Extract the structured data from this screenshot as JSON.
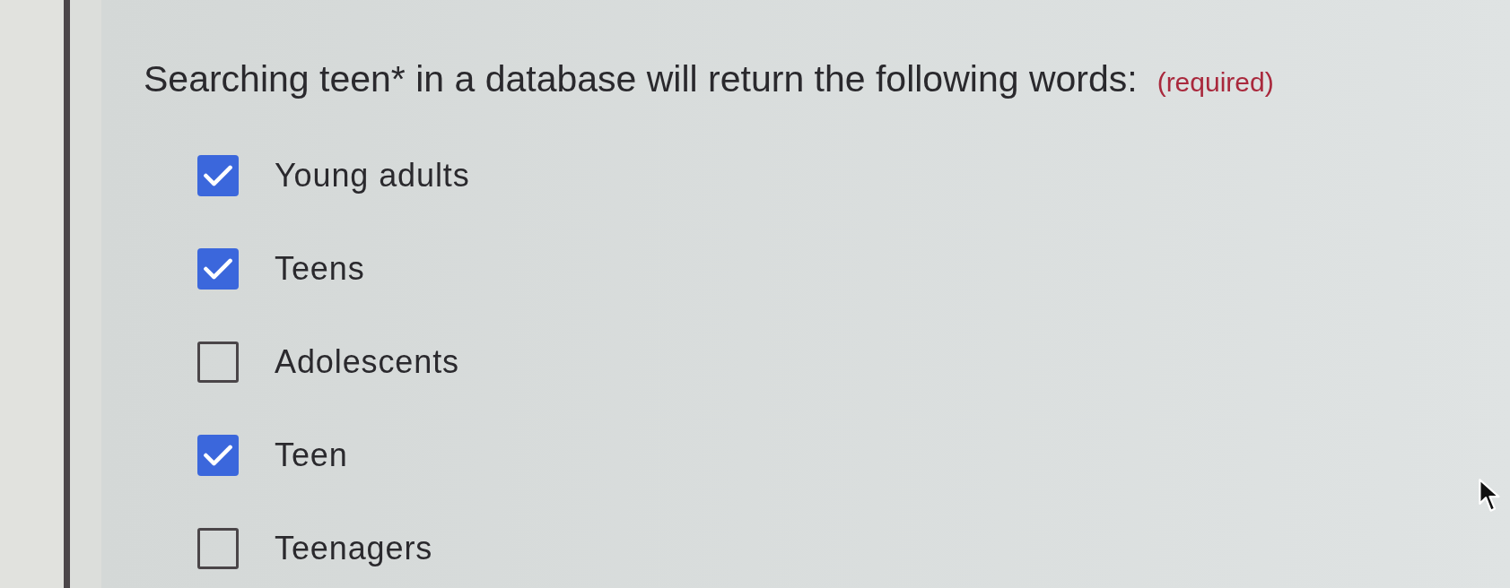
{
  "question": {
    "text": "Searching teen* in a database will return the following words:",
    "required_label": "(required)"
  },
  "options": [
    {
      "label": "Young adults",
      "checked": true
    },
    {
      "label": "Teens",
      "checked": true
    },
    {
      "label": "Adolescents",
      "checked": false
    },
    {
      "label": "Teen",
      "checked": true
    },
    {
      "label": "Teenagers",
      "checked": false
    }
  ]
}
